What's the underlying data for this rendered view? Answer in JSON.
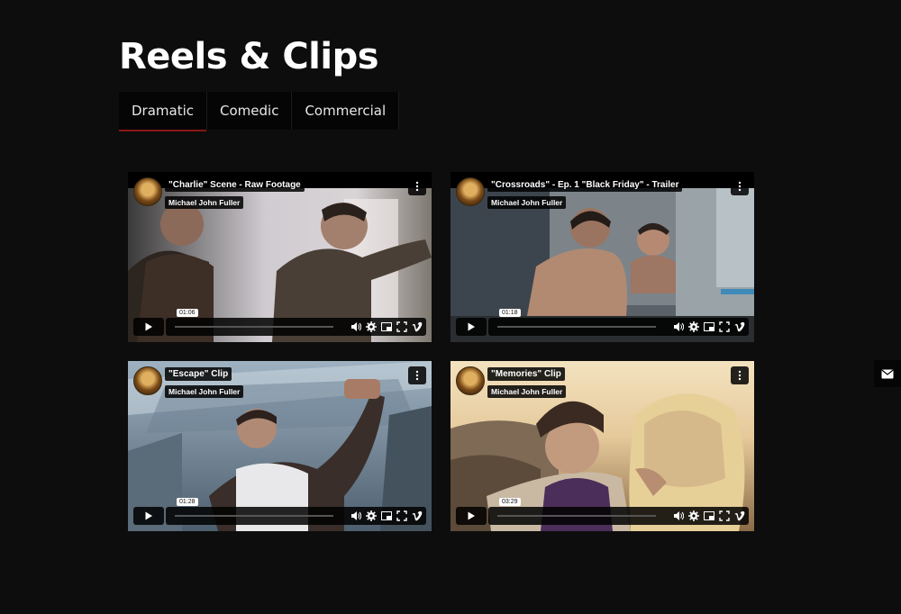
{
  "page": {
    "title": "Reels & Clips"
  },
  "tabs": [
    {
      "label": "Dramatic",
      "active": true
    },
    {
      "label": "Comedic",
      "active": false
    },
    {
      "label": "Commercial",
      "active": false
    }
  ],
  "videos": [
    {
      "title": "\"Charlie\" Scene - Raw Footage",
      "author": "Michael John Fuller",
      "time": "01:06"
    },
    {
      "title": "\"Crossroads\" - Ep. 1 \"Black Friday\" - Trailer",
      "author": "Michael John Fuller",
      "time": "01:18"
    },
    {
      "title": "\"Escape\" Clip",
      "author": "Michael John Fuller",
      "time": "01:28"
    },
    {
      "title": "\"Memories\" Clip",
      "author": "Michael John Fuller",
      "time": "03:29"
    }
  ],
  "icons": {
    "menu": "more-vertical-icon",
    "play": "play-icon",
    "volume": "volume-icon",
    "settings": "gear-icon",
    "pip": "picture-in-picture-icon",
    "fullscreen": "fullscreen-icon",
    "vimeo": "vimeo-logo-icon",
    "contact": "mail-icon"
  },
  "colors": {
    "background": "#0d0d0d",
    "tab_accent": "#8b1717"
  }
}
